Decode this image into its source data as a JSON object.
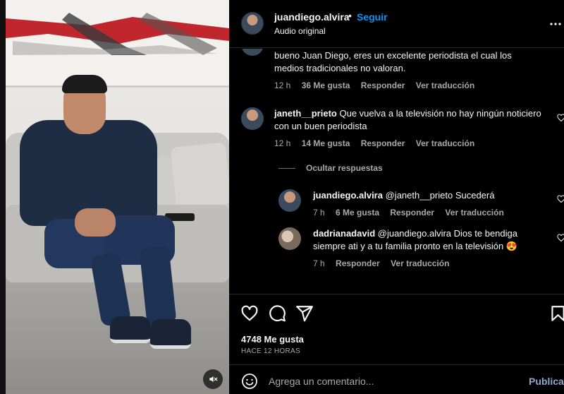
{
  "header": {
    "username": "juandiego.alvira",
    "separator": "•",
    "follow_label": "Seguir",
    "audio_label": "Audio original",
    "more_icon": "more-horizontal-icon"
  },
  "comments": [
    {
      "username": "",
      "text": "bueno Juan Diego, eres un excelente periodista el cual los medios tradicionales no valoran.",
      "time": "12 h",
      "likes": "36 Me gusta",
      "reply": "Responder",
      "translate": "Ver traducción"
    },
    {
      "username": "janeth__prieto",
      "text": "Que vuelva a la televisión no hay ningún noticiero con un buen periodista",
      "time": "12 h",
      "likes": "14 Me gusta",
      "reply": "Responder",
      "translate": "Ver traducción"
    }
  ],
  "hide_replies": "Ocultar respuestas",
  "replies": [
    {
      "username": "juandiego.alvira",
      "text": "@janeth__prieto Sucederá",
      "time": "7 h",
      "likes": "6 Me gusta",
      "reply": "Responder",
      "translate": "Ver traducción"
    },
    {
      "username": "dadrianadavid",
      "text": "@juandiego.alvira Dios te bendiga siempre ati y a tu familia pronto en la televisión 😍",
      "time": "7 h",
      "reply": "Responder",
      "translate": "Ver traducción"
    }
  ],
  "actions": {
    "likes": "4748 Me gusta",
    "posted": "HACE 12 HORAS",
    "icons": [
      "heart-icon",
      "comment-icon",
      "share-icon",
      "bookmark-icon"
    ]
  },
  "composer": {
    "placeholder": "Agrega un comentario...",
    "post_label": "Publicar",
    "emoji_icon": "emoji-icon"
  },
  "media": {
    "mute_icon": "speaker-muted-icon"
  },
  "colors": {
    "background": "#000000",
    "accent": "#0095f6",
    "muted_text": "#a8a8a8",
    "divider": "#262626"
  }
}
